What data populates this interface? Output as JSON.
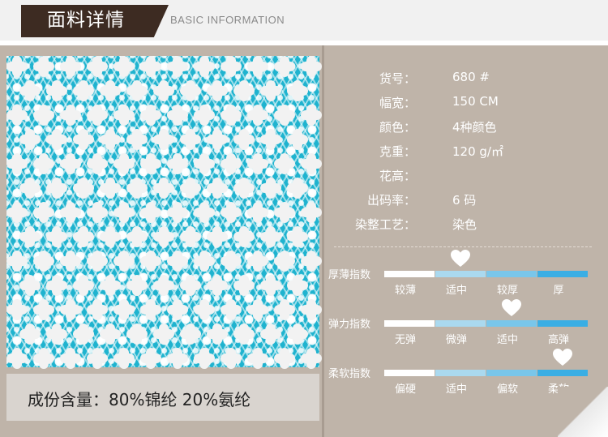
{
  "header": {
    "title_cn": "面料详情",
    "title_en": "BASIC INFORMATION"
  },
  "composition": "成份含量：80%锦纶 20%氨纶",
  "specs": [
    {
      "label": "货号：",
      "value": "680 #"
    },
    {
      "label": "幅宽：",
      "value": "150 CM"
    },
    {
      "label": "颜色：",
      "value": "4种颜色"
    },
    {
      "label": "克重：",
      "value": "120 g/㎡"
    },
    {
      "label": "花高：",
      "value": ""
    },
    {
      "label": "出码率：",
      "value": "6 码"
    },
    {
      "label": "染整工艺：",
      "value": "染色"
    }
  ],
  "indices": [
    {
      "label": "厚薄指数",
      "levels": [
        "较薄",
        "适中",
        "较厚",
        "厚"
      ],
      "selected": 1
    },
    {
      "label": "弹力指数",
      "levels": [
        "无弹",
        "微弹",
        "适中",
        "高弹"
      ],
      "selected": 2
    },
    {
      "label": "柔软指数",
      "levels": [
        "偏硬",
        "适中",
        "偏软",
        "柔软"
      ],
      "selected": 3
    }
  ],
  "colors": {
    "bar1": "#ffffff",
    "bar2": "#aad9ef",
    "bar3": "#79c6ea",
    "bar4": "#3aaee4",
    "fabric": "#1fb3cf"
  },
  "icons": {
    "marker": "heart-icon"
  }
}
